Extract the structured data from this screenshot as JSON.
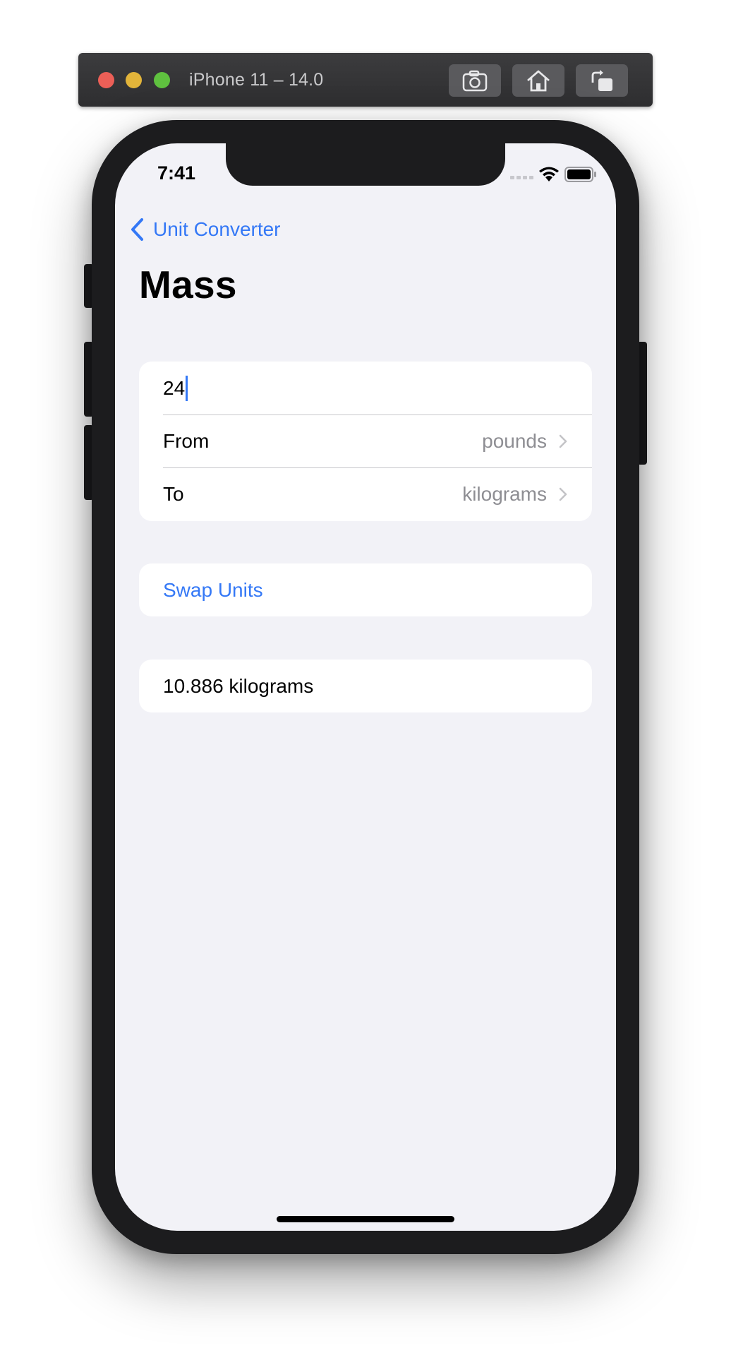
{
  "simulator": {
    "title": "iPhone 11 – 14.0",
    "toolbar_icons": [
      "camera-icon",
      "home-icon",
      "rotate-icon"
    ]
  },
  "status_bar": {
    "time": "7:41",
    "icons": [
      "signal-icon",
      "wifi-icon",
      "battery-icon"
    ]
  },
  "nav": {
    "back_label": "Unit Converter",
    "title": "Mass"
  },
  "form": {
    "amount_value": "24",
    "from_label": "From",
    "from_value": "pounds",
    "to_label": "To",
    "to_value": "kilograms",
    "swap_label": "Swap Units",
    "result": "10.886 kilograms"
  },
  "colors": {
    "accent": "#3478f6",
    "background": "#f2f2f7",
    "secondary_text": "#8e8e93"
  }
}
